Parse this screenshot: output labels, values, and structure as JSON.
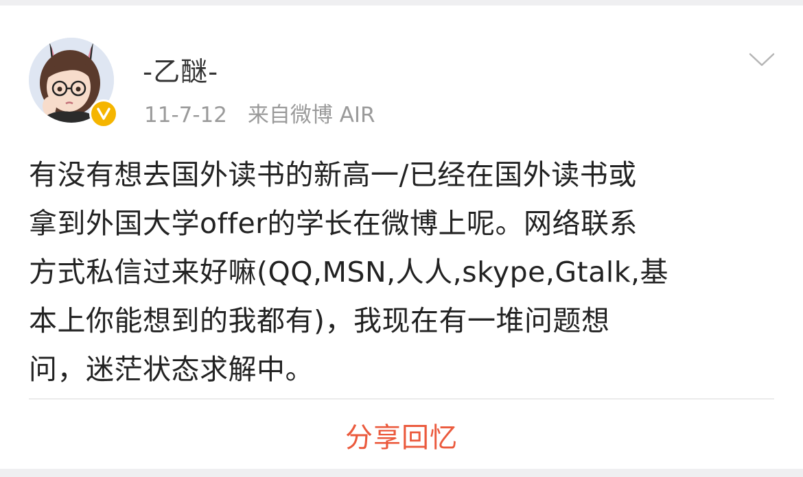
{
  "post": {
    "username": "-乙醚-",
    "date": "11-7-12",
    "source": "来自微博 AIR",
    "text_lines": [
      "有没有想去国外读书的新高一/已经在国外读书或",
      "拿到外国大学offer的学长在微博上呢。网络联系",
      "方式私信过来好嘛(QQ,MSN,人人,skype,Gtalk,基",
      "本上你能想到的我都有)，我现在有一堆问题想",
      "问，迷茫状态求解中。"
    ],
    "avatar_icon": "cartoon-girl-avatar-icon",
    "verified_icon": "verified-v-badge-icon",
    "menu_icon": "chevron-down-icon"
  },
  "footer": {
    "share_label": "分享回忆"
  },
  "colors": {
    "accent": "#eb5a3d",
    "verified": "#f5b500",
    "meta_text": "#9a9a9a",
    "body_text": "#222222",
    "background": "#efeff1"
  }
}
